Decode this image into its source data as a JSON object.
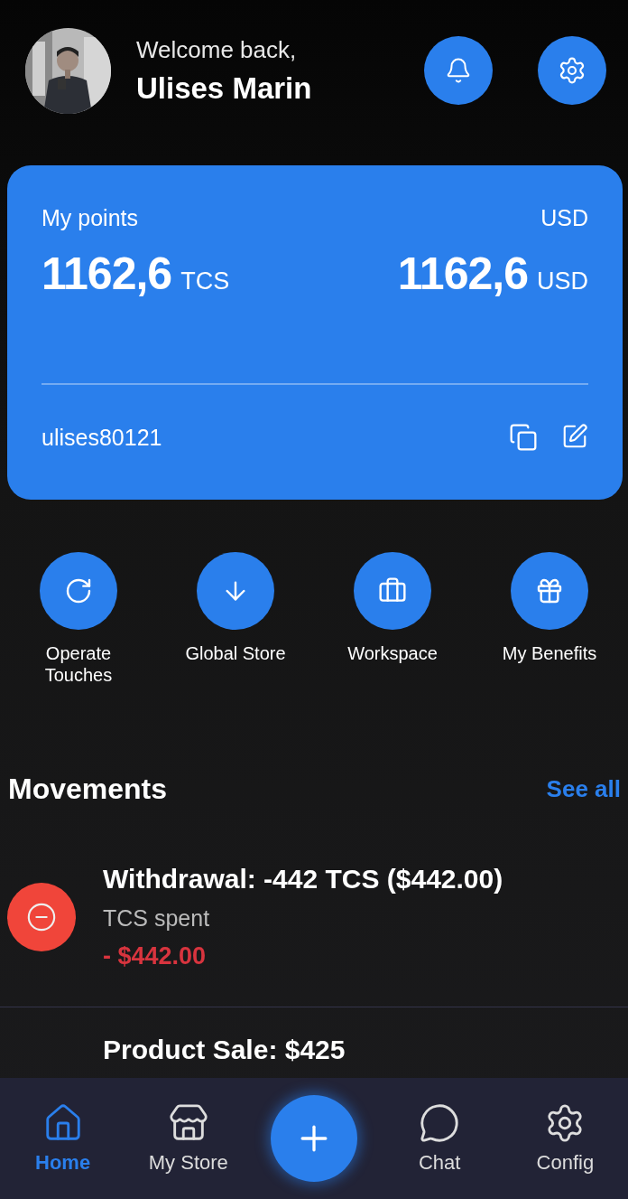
{
  "header": {
    "greeting": "Welcome back,",
    "name": "Ulises Marin"
  },
  "card": {
    "label": "My points",
    "currency_label": "USD",
    "points_value": "1162,6",
    "points_unit": "TCS",
    "usd_value": "1162,6",
    "usd_unit": "USD",
    "username": "ulises80121"
  },
  "actions": [
    {
      "label": "Operate Touches",
      "kind": "refresh"
    },
    {
      "label": "Global Store",
      "kind": "download"
    },
    {
      "label": "Workspace",
      "kind": "briefcase"
    },
    {
      "label": "My Benefits",
      "kind": "gift"
    }
  ],
  "movements": {
    "title": "Movements",
    "see_all": "See all",
    "items": [
      {
        "kind": "withdrawal",
        "title": "Withdrawal: -442 TCS ($442.00)",
        "subtitle": "TCS spent",
        "amount": "- $442.00"
      },
      {
        "kind": "partial",
        "title": "Product Sale: $425"
      }
    ]
  },
  "nav": {
    "items": [
      {
        "label": "Home",
        "kind": "home",
        "selected": true
      },
      {
        "label": "My Store",
        "kind": "store",
        "selected": false
      },
      {
        "kind": "fab"
      },
      {
        "label": "Chat",
        "kind": "chat",
        "selected": false
      },
      {
        "label": "Config",
        "kind": "config",
        "selected": false
      }
    ]
  }
}
